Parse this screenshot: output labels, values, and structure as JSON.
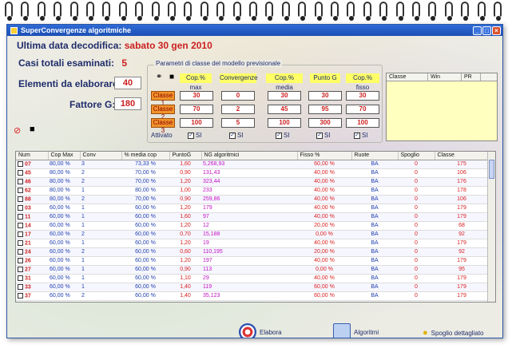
{
  "window": {
    "title": "SuperConvergenze algoritmiche",
    "buttons": [
      "_",
      "□",
      "×"
    ]
  },
  "info": {
    "last_decode_label": "Ultima data decodifica:",
    "last_decode_value": "sabato 30 gen 2010",
    "total_cases_label": "Casi totali esaminati:",
    "total_cases_value": "5",
    "elements_label": "Elementi da elaborare:",
    "elements_value": "40",
    "factor_label": "Fattore G:",
    "factor_value": "180"
  },
  "params": {
    "legend": "Parametri di classe del modello previsionale",
    "headers": [
      "Cop.% max",
      "Convergenze",
      "Cop.% media",
      "Punto G",
      "Cop.% fisso"
    ],
    "classes": [
      {
        "label": "Classe 1",
        "values": [
          "30",
          "0",
          "30",
          "30",
          "30"
        ]
      },
      {
        "label": "Classe 2",
        "values": [
          "70",
          "2",
          "45",
          "95",
          "70"
        ]
      },
      {
        "label": "Classe 3",
        "values": [
          "100",
          "5",
          "100",
          "300",
          "100"
        ]
      }
    ],
    "active_label": "Attivato",
    "active_checks": [
      "SI",
      "SI",
      "SI",
      "SI",
      "SI"
    ]
  },
  "mini_table": {
    "headers": [
      "Classe",
      "Win",
      "PR"
    ]
  },
  "grid": {
    "headers": [
      "Num",
      "Cop Max",
      "Conv",
      "% media cop",
      "PuntoG",
      "NG algoritmici",
      "Fisso %",
      "Ruote",
      "Spoglio",
      "Classe"
    ],
    "rows": [
      [
        "07",
        "80,00 %",
        "3",
        "73,33 %",
        "1,60",
        "5,268,93",
        "60,00 %",
        "BA",
        "0",
        "175"
      ],
      [
        "45",
        "80,00 %",
        "2",
        "70,00 %",
        "0,90",
        "131,43",
        "40,00 %",
        "BA",
        "0",
        "106"
      ],
      [
        "46",
        "80,00 %",
        "2",
        "70,00 %",
        "1,20",
        "323,44",
        "40,00 %",
        "BA",
        "0",
        "176"
      ],
      [
        "62",
        "80,00 %",
        "1",
        "80,00 %",
        "1,00",
        "233",
        "40,00 %",
        "BA",
        "0",
        "178"
      ],
      [
        "88",
        "80,00 %",
        "2",
        "70,00 %",
        "0,90",
        "259,86",
        "40,00 %",
        "BA",
        "0",
        "106"
      ],
      [
        "03",
        "60,00 %",
        "1",
        "60,00 %",
        "1,20",
        "179",
        "40,00 %",
        "BA",
        "0",
        "179"
      ],
      [
        "11",
        "60,00 %",
        "1",
        "60,00 %",
        "1,60",
        "97",
        "40,00 %",
        "BA",
        "0",
        "179"
      ],
      [
        "14",
        "60,00 %",
        "1",
        "60,00 %",
        "1,20",
        "12",
        "20,00 %",
        "BA",
        "0",
        "68"
      ],
      [
        "17",
        "60,00 %",
        "2",
        "60,00 %",
        "0,70",
        "15,188",
        "0,00 %",
        "BA",
        "0",
        "92"
      ],
      [
        "21",
        "60,00 %",
        "1",
        "60,00 %",
        "1,20",
        "19",
        "40,00 %",
        "BA",
        "0",
        "179"
      ],
      [
        "24",
        "60,00 %",
        "2",
        "60,00 %",
        "0,60",
        "110,195",
        "20,00 %",
        "BA",
        "0",
        "92"
      ],
      [
        "26",
        "60,00 %",
        "1",
        "60,00 %",
        "1,20",
        "197",
        "40,00 %",
        "BA",
        "0",
        "179"
      ],
      [
        "27",
        "60,00 %",
        "1",
        "60,00 %",
        "0,90",
        "113",
        "0,00 %",
        "BA",
        "0",
        "95"
      ],
      [
        "31",
        "60,00 %",
        "1",
        "60,00 %",
        "1,10",
        "29",
        "40,00 %",
        "BA",
        "0",
        "179"
      ],
      [
        "33",
        "60,00 %",
        "1",
        "60,00 %",
        "1,40",
        "119",
        "60,00 %",
        "BA",
        "0",
        "179"
      ],
      [
        "37",
        "60,00 %",
        "2",
        "60,00 %",
        "1,40",
        "35,123",
        "60,00 %",
        "BA",
        "0",
        "179"
      ]
    ]
  },
  "footer": {
    "ellipsis": "...",
    "elabora_label": "Elabora",
    "algoritmi_label": "Algoritmi",
    "spoglio_label": "Spoglio dettagliato"
  },
  "colors": {
    "accent_red": "#cc1f1f",
    "label_blue": "#1f2d6b",
    "header_yellow": "#ffff66",
    "class_orange": "#f0932b"
  }
}
